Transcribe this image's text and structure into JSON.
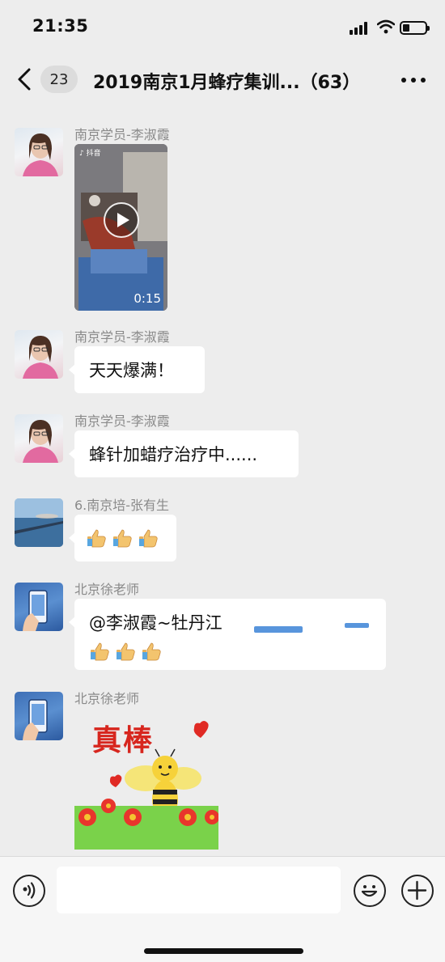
{
  "status_bar": {
    "time": "21:35"
  },
  "nav": {
    "unread_count": "23",
    "title": "2019南京1月蜂疗集训...（63）"
  },
  "messages": [
    {
      "sender": "南京学员-李淑霞",
      "type": "video",
      "duration": "0:15"
    },
    {
      "sender": "南京学员-李淑霞",
      "type": "text",
      "text": "天天爆满！"
    },
    {
      "sender": "南京学员-李淑霞",
      "type": "text",
      "text": "蜂针加蜡疗治疗中......"
    },
    {
      "sender": "6.南京培-张有生",
      "type": "emoji",
      "emoji": "thumbs-up x3"
    },
    {
      "sender": "北京徐老师",
      "type": "mention",
      "text": "@李淑霞~牡丹江",
      "emoji": "thumbs-up x3"
    },
    {
      "sender": "北京徐老师",
      "type": "sticker",
      "sticker_text": "真棒"
    }
  ],
  "input_bar": {
    "placeholder": ""
  },
  "icons": {
    "back": "chevron-left-icon",
    "more": "more-dots-icon",
    "voice": "voice-icon",
    "emoji": "emoji-icon",
    "plus": "plus-icon"
  },
  "colors": {
    "background": "#ededed",
    "bubble": "#ffffff",
    "sender_text": "#8a8a8a",
    "sticker_red": "#d7261e"
  }
}
